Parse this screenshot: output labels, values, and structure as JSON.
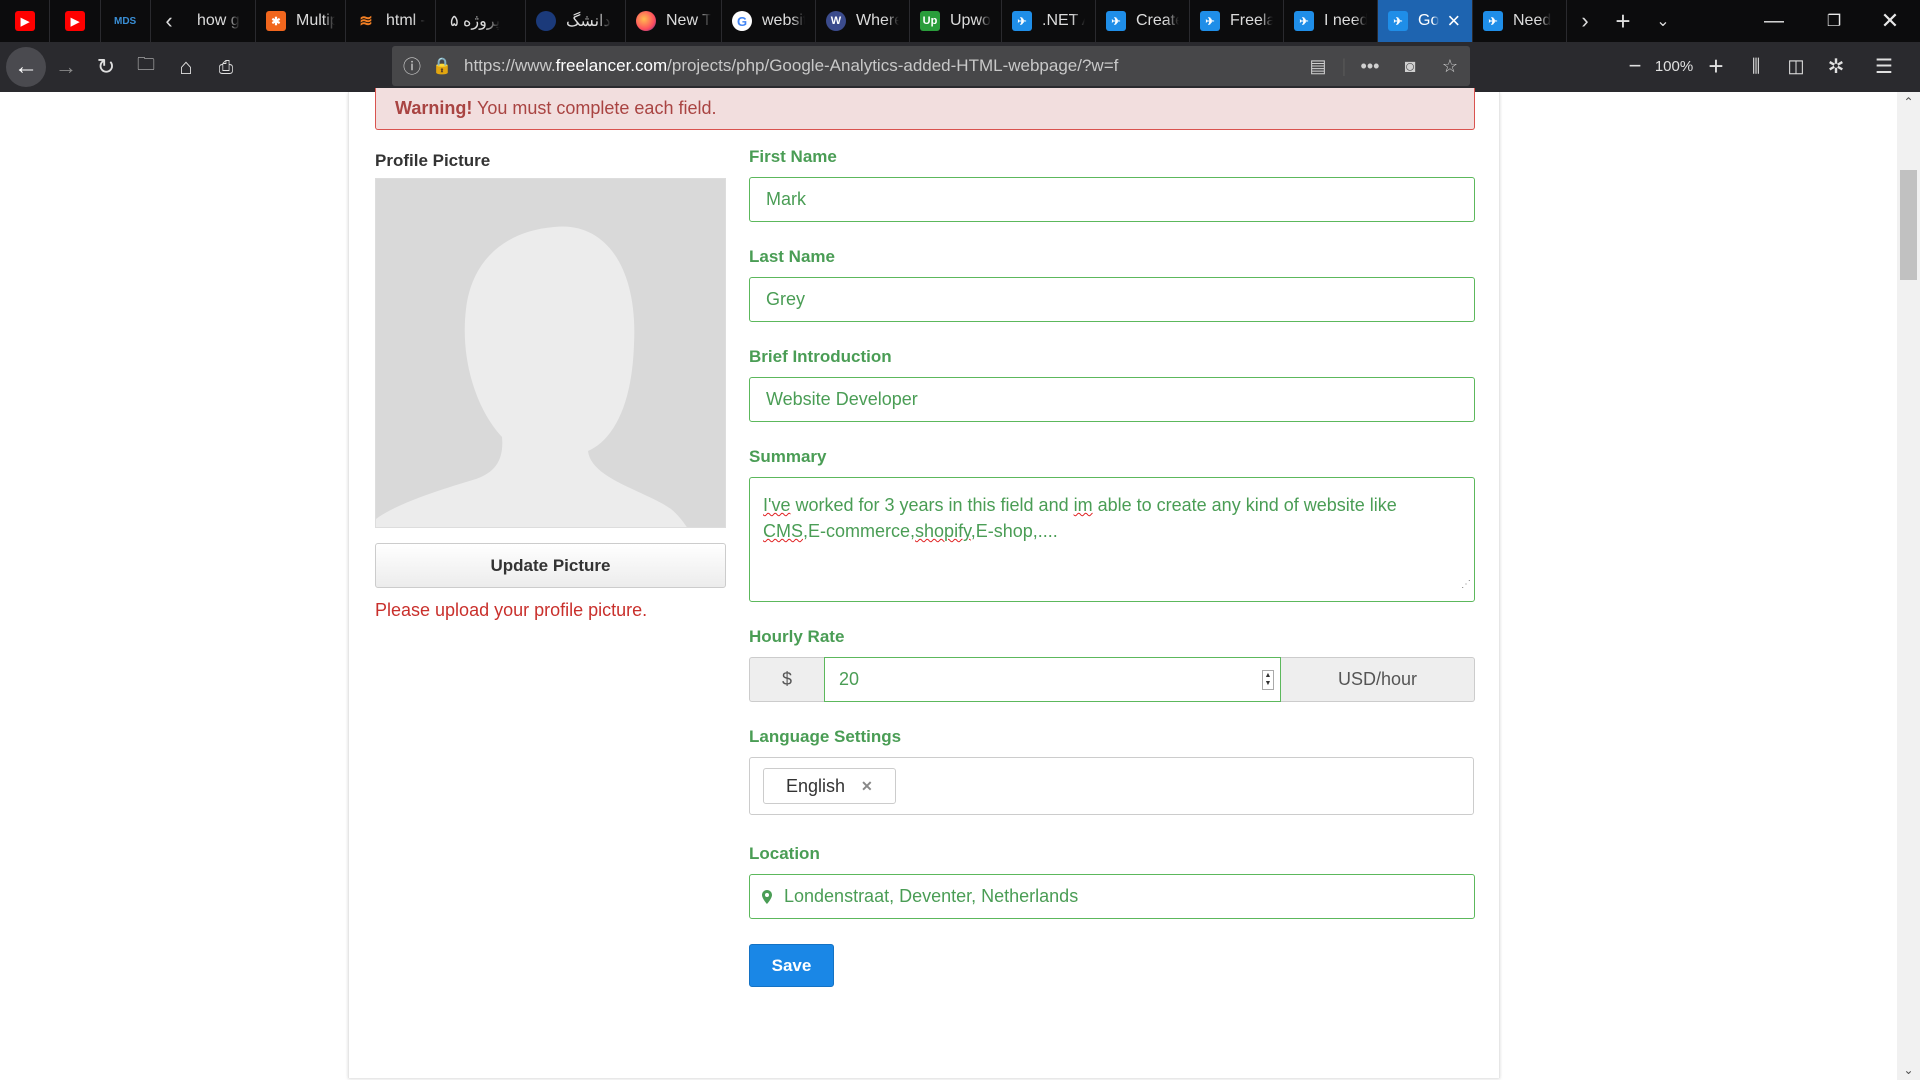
{
  "browser": {
    "tabs": [
      {
        "label": "",
        "icon": "youtube-icon"
      },
      {
        "label": "",
        "icon": "youtube-icon"
      },
      {
        "label": "",
        "icon": "mds-icon"
      },
      {
        "label": "how g",
        "icon": "stackoverflow-icon"
      },
      {
        "label": "Multip",
        "icon": "orange-star-icon"
      },
      {
        "label": "html -",
        "icon": "stackoverflow-icon"
      },
      {
        "label": "پروژه ۵",
        "icon": ""
      },
      {
        "label": "دانشگ",
        "icon": "university-icon"
      },
      {
        "label": "New T",
        "icon": "firefox-icon"
      },
      {
        "label": "websit",
        "icon": "google-icon"
      },
      {
        "label": "Where",
        "icon": "wordpress-icon"
      },
      {
        "label": "Upwo",
        "icon": "upwork-icon"
      },
      {
        "label": ".NET A",
        "icon": "freelancer-icon"
      },
      {
        "label": "Create",
        "icon": "freelancer-icon"
      },
      {
        "label": "Freela",
        "icon": "freelancer-icon"
      },
      {
        "label": "I need",
        "icon": "freelancer-icon"
      },
      {
        "label": "Go",
        "icon": "freelancer-icon",
        "active": true
      },
      {
        "label": "Need",
        "icon": "freelancer-icon"
      }
    ],
    "url_prefix": "https://www.",
    "url_domain": "freelancer.com",
    "url_path": "/projects/php/Google-Analytics-added-HTML-webpage/?w=f",
    "zoom": "100%"
  },
  "alert": {
    "strong": "Warning!",
    "text": " You must complete each field."
  },
  "profile": {
    "picture_label": "Profile Picture",
    "update_button": "Update Picture",
    "error": "Please upload your profile picture."
  },
  "form": {
    "first_name_label": "First Name",
    "first_name_value": "Mark",
    "last_name_label": "Last Name",
    "last_name_value": "Grey",
    "intro_label": "Brief Introduction",
    "intro_value": "Website Developer",
    "summary_label": "Summary",
    "summary_parts": [
      "I've",
      " worked for 3 years in this field and ",
      "im",
      " able to create any kind of website like ",
      "CMS",
      ",E-commerce,",
      "shopify",
      ",E-shop,...."
    ],
    "rate_label": "Hourly Rate",
    "rate_prefix": "$",
    "rate_value": "20",
    "rate_suffix": "USD/hour",
    "language_label": "Language Settings",
    "language_chip": "English",
    "location_label": "Location",
    "location_value": "Londenstraat, Deventer, Netherlands",
    "save_button": "Save"
  },
  "colors": {
    "success_green": "#5cb85c",
    "label_green": "#4a9d55",
    "danger_red": "#c9302c",
    "primary_blue": "#1a87e6",
    "active_tab": "#1e64b0"
  }
}
